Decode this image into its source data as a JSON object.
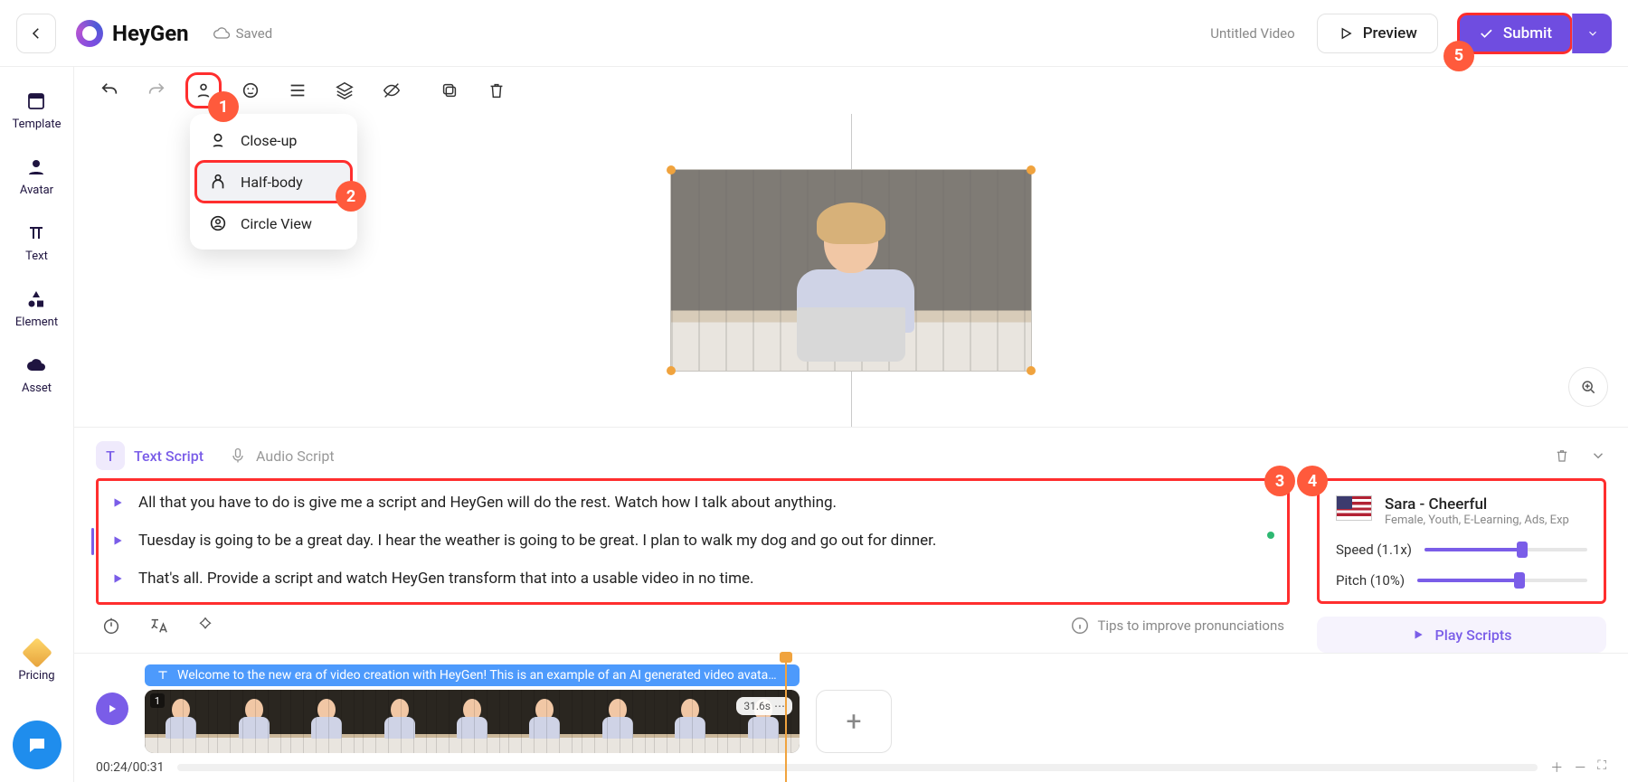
{
  "header": {
    "brand": "HeyGen",
    "saved": "Saved",
    "title": "Untitled Video",
    "preview": "Preview",
    "submit": "Submit"
  },
  "sidebar": {
    "items": [
      "Template",
      "Avatar",
      "Text",
      "Element",
      "Asset",
      "Pricing"
    ]
  },
  "dropdown": {
    "closeup": "Close-up",
    "halfbody": "Half-body",
    "circle": "Circle View"
  },
  "script": {
    "textTab": "Text Script",
    "audioTab": "Audio Script",
    "lines": [
      "All that you have to do is give me a script and HeyGen will do the rest. Watch how I talk about anything.",
      "Tuesday is going to be a great day. I hear the weather is going to be great. I plan to walk my dog and go out for dinner.",
      "That's all. Provide a script and watch HeyGen transform that into a usable video in no time."
    ],
    "tips": "Tips to improve pronunciations"
  },
  "voice": {
    "name": "Sara - Cheerful",
    "desc": "Female, Youth, E-Learning, Ads, Exp",
    "speedLabel": "Speed (1.1x)",
    "pitchLabel": "Pitch (10%)",
    "play": "Play Scripts"
  },
  "timeline": {
    "caption": "Welcome to the new era of video creation with HeyGen! This is an example of an AI generated video avata…",
    "duration": "31.6s",
    "clipNumber": "1",
    "time": "00:24/00:31"
  },
  "badges": {
    "b1": "1",
    "b2": "2",
    "b3": "3",
    "b4": "4",
    "b5": "5"
  }
}
